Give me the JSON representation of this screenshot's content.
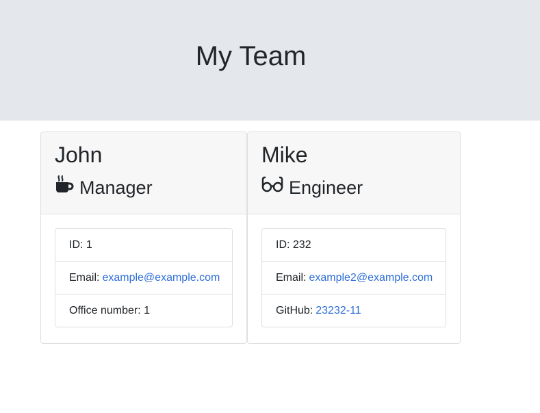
{
  "header": {
    "title": "My Team"
  },
  "colors": {
    "jumbotron": "#e4e7eb",
    "link": "#2f6fd8",
    "card_header": "#f7f7f7"
  },
  "cards": [
    {
      "name": "John",
      "role": "Manager",
      "role_icon": "coffee-mug-icon",
      "id_label": "ID:",
      "id_value": "1",
      "email_label": "Email:",
      "email_value": "example@example.com",
      "extra_label": "Office number:",
      "extra_value": "1"
    },
    {
      "name": "Mike",
      "role": "Engineer",
      "role_icon": "glasses-icon",
      "id_label": "ID:",
      "id_value": "232",
      "email_label": "Email:",
      "email_value": "example2@example.com",
      "extra_label": "GitHub:",
      "extra_value": "23232-11"
    }
  ]
}
